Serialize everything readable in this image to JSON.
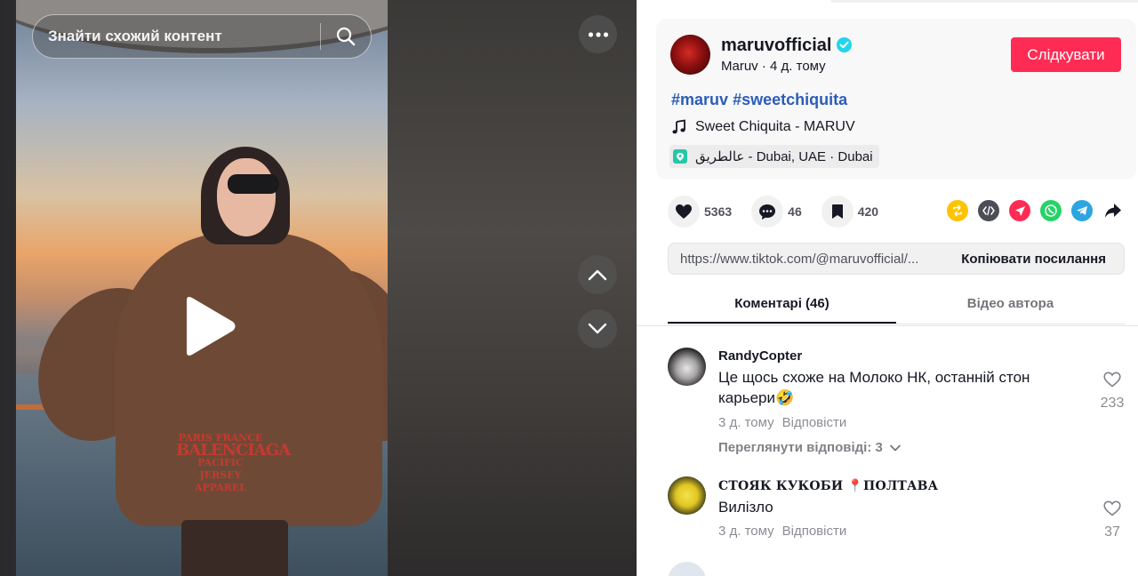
{
  "video": {
    "search_placeholder": "Знайти схожий контент",
    "hoodie_text_top": "PARIS FRANCE",
    "hoodie_text_main": "BALENCIAGA",
    "hoodie_text_bottom": "PACIFIC JERSEY APPAREL"
  },
  "author": {
    "username": "maruvofficial",
    "display_name": "Maruv",
    "posted": "4 д. тому",
    "follow_label": "Слідкувати"
  },
  "post": {
    "hashtags": [
      "#maruv",
      "#sweetchiquita"
    ],
    "music": "Sweet Chiquita - MARUV",
    "location": "عالطريق - Dubai, UAE · Dubai"
  },
  "actions": {
    "likes": "5363",
    "comments": "46",
    "saves": "420"
  },
  "share_icons": [
    "repost-icon",
    "embed-icon",
    "direct-message-icon",
    "whatsapp-icon",
    "telegram-icon",
    "share-arrow-icon"
  ],
  "colors": {
    "accent": "#fe2c55",
    "hashtag": "#2b5db9",
    "verified": "#20d5ec",
    "repost": "#ffc300",
    "embed": "#4b4d57",
    "dm": "#fe2c55",
    "whatsapp": "#25d366",
    "telegram": "#2ca5e0"
  },
  "link": {
    "url": "https://www.tiktok.com/@maruvofficial/...",
    "copy_label": "Копіювати посилання"
  },
  "tabs": [
    {
      "label": "Коментарі (46)",
      "active": true
    },
    {
      "label": "Відео автора",
      "active": false
    }
  ],
  "comments": [
    {
      "user": "RandyCopter",
      "text": "Це щось схоже на Молоко НК, останній стон карьери🤣",
      "time": "3 д. тому",
      "reply_label": "Відповісти",
      "likes": "233",
      "view_replies": "Переглянути відповіді: 3"
    },
    {
      "user": "СТОЯК КУКОБИ 📍ПОЛТАВА",
      "text": "Вилізло",
      "time": "3 д. тому",
      "reply_label": "Відповісти",
      "likes": "37"
    }
  ]
}
